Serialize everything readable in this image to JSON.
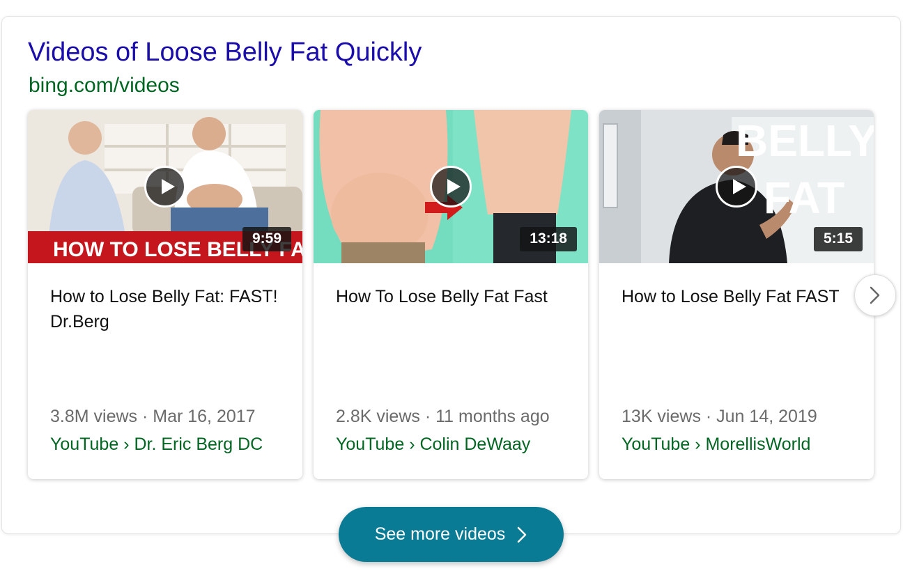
{
  "header": {
    "title": "Videos of Loose Belly Fat Quickly",
    "source": "bing.com/videos"
  },
  "videos": [
    {
      "title": "How to Lose Belly Fat: FAST! Dr.Berg",
      "duration": "9:59",
      "meta": "3.8M views · Mar 16, 2017",
      "channel": "YouTube › Dr. Eric Berg DC",
      "thumb_text": "HOW TO LOSE BELLY FAT"
    },
    {
      "title": "How To Lose Belly Fat Fast",
      "duration": "13:18",
      "meta": "2.8K views · 11 months ago",
      "channel": "YouTube › Colin DeWaay"
    },
    {
      "title": "How to Lose Belly Fat FAST",
      "duration": "5:15",
      "meta": "13K views · Jun 14, 2019",
      "channel": "YouTube › MorellisWorld",
      "thumb_text_1": "BELLY",
      "thumb_text_2": "FAT"
    }
  ],
  "see_more": {
    "label": "See more videos"
  },
  "icons": {
    "play": "play-icon",
    "next": "chevron-right-icon",
    "see_more_chevron": "chevron-right-icon"
  },
  "colors": {
    "title": "#1a0dab",
    "source": "#006621",
    "button": "#0a7b95"
  }
}
